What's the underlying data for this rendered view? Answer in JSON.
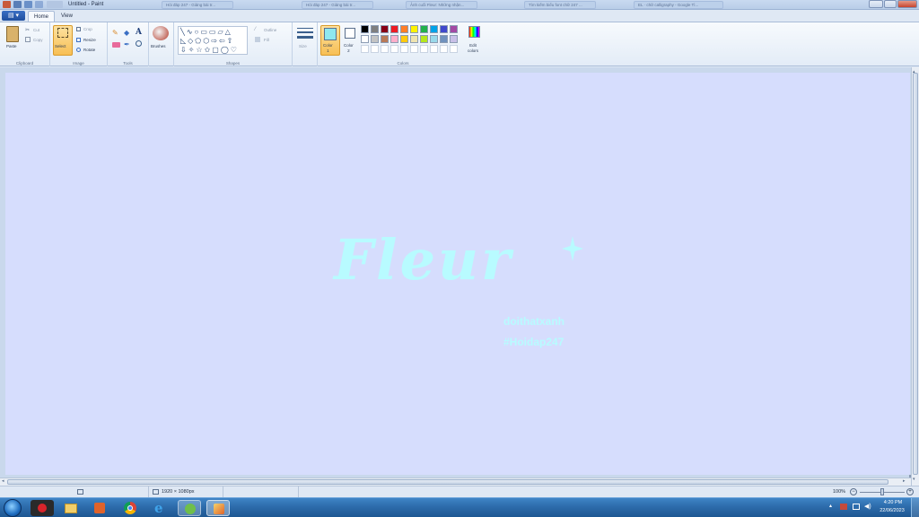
{
  "window": {
    "title": "Untitled - Paint",
    "background_tabs": [
      "Hỏi đáp 247 - Giảng bài tr...",
      "Hỏi đáp 247 - Giảng bài tr...",
      "Ảnh cuối Fleur: Những nhận...",
      "Tìm kiếm biểu font chữ 247 ...",
      "EL · chữ calligraphy - Google Tì..."
    ]
  },
  "menu": {
    "file_icon": "file-menu-icon",
    "tabs": [
      "Home",
      "View"
    ]
  },
  "ribbon": {
    "clipboard": {
      "paste": "Paste",
      "cut": "Cut",
      "copy": "Copy",
      "label": "Clipboard"
    },
    "image": {
      "select": "Select",
      "crop": "Crop",
      "resize": "Resize",
      "rotate": "Rotate",
      "label": "Image"
    },
    "tools": {
      "label": "Tools"
    },
    "brushes": {
      "label": "Brushes"
    },
    "shapes": {
      "outline": "Outline",
      "fill": "Fill",
      "label": "Shapes"
    },
    "size": {
      "label": "Size"
    },
    "colors": {
      "color1": "Color\n1",
      "color2": "Color\n2",
      "edit": "Edit\ncolors",
      "label": "Colors",
      "color1_value": "#8fe8ef",
      "color2_value": "#ffffff",
      "palette_row1": [
        "#000000",
        "#7f7f7f",
        "#880015",
        "#ed1c24",
        "#ff7f27",
        "#fff200",
        "#22b14c",
        "#00a2e8",
        "#3f48cc",
        "#a349a4"
      ],
      "palette_row2": [
        "#ffffff",
        "#c3c3c3",
        "#b97a57",
        "#ffaec9",
        "#ffc90e",
        "#efe4b0",
        "#b5e61d",
        "#99d9ea",
        "#7092be",
        "#c8bfe7"
      ],
      "palette_row3": [
        "#ffffff",
        "#ffffff",
        "#ffffff",
        "#ffffff",
        "#ffffff",
        "#ffffff",
        "#ffffff",
        "#ffffff",
        "#ffffff",
        "#ffffff"
      ]
    }
  },
  "canvas": {
    "background": "#d6ddfd",
    "title_text": "Fleur",
    "line1": "doithatxanh",
    "line2": "#Hoidap247",
    "text_color": "#b8fbff"
  },
  "status": {
    "dimensions": "1920 × 1080px",
    "zoom": "100%"
  },
  "taskbar": {
    "apps": [
      "start-orb",
      "garena-icon",
      "file-explorer-icon",
      "media-player-icon",
      "chrome-icon",
      "internet-explorer-icon",
      "app-icon",
      "paint-icon"
    ],
    "time": "4:20 PM",
    "date": "22/06/2023"
  }
}
